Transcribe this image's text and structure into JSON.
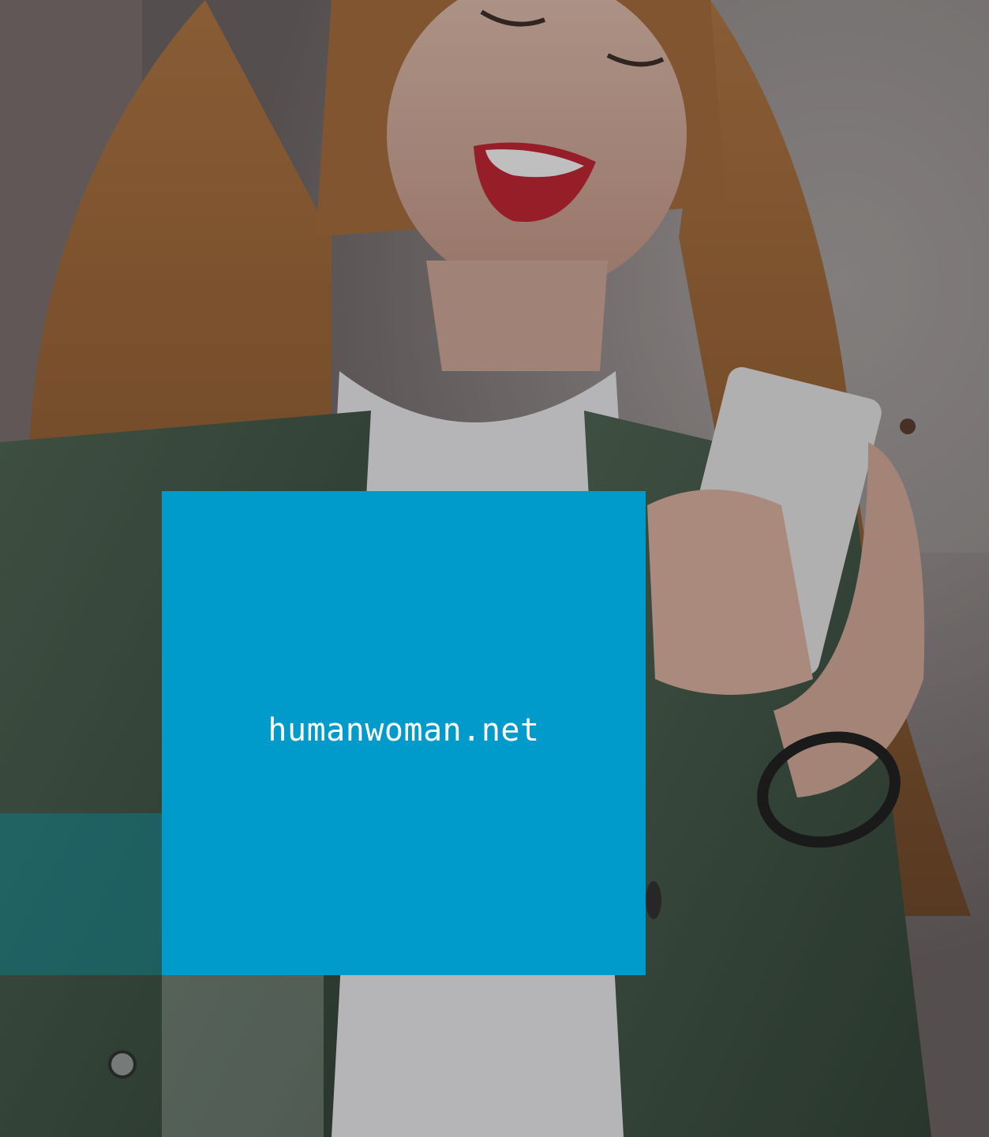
{
  "site": {
    "domain": "humanwoman.net"
  },
  "colors": {
    "brand_square": "#009bcb",
    "teal_panel": "#008ca0",
    "text": "#ffffff"
  }
}
